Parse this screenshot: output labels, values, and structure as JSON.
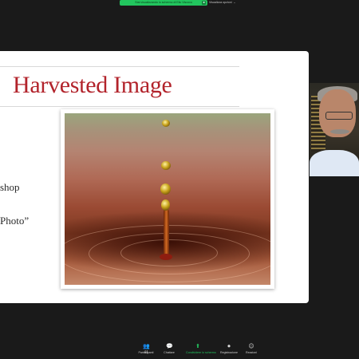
{
  "banner": {
    "share_text": "Stai visualizzando lo schermo di Elio Viscovo",
    "end_symbol": "■",
    "view_options": "Visualizza opzioni",
    "view_options_caret": "⌄"
  },
  "slide": {
    "title": "Harvested Image",
    "bullet_1": "shop",
    "bullet_2": "Photo”"
  },
  "photo": {
    "subject_icon": "water-drop-splash"
  },
  "participant": {
    "video_icon": "participant-video"
  },
  "toolbar": {
    "participants": {
      "label": "Partecipanti",
      "count": "81",
      "icon": "👥"
    },
    "chat": {
      "label": "Chattare",
      "icon": "💬"
    },
    "share": {
      "label": "Condividere lo schermo",
      "icon": "⬆"
    },
    "record": {
      "label": "Registrazione",
      "icon": "⏺"
    },
    "reactions": {
      "label": "Reazioni",
      "icon": "☺"
    }
  },
  "colors": {
    "accent_green": "#22c55e",
    "title_red": "#b2232b",
    "background": "#1a1a1a"
  }
}
